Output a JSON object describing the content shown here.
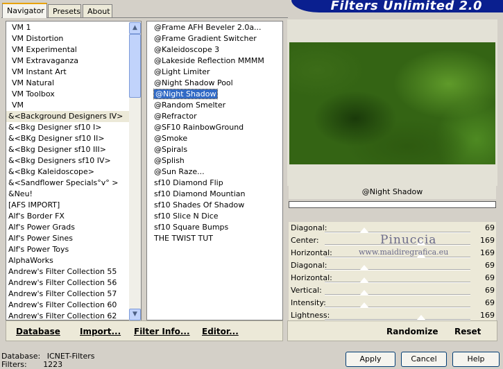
{
  "tabs": [
    {
      "label": "Navigator"
    },
    {
      "label": "Presets"
    },
    {
      "label": "About"
    }
  ],
  "banner": {
    "title": "Filters Unlimited 2.0"
  },
  "categories": [
    "VM 1",
    "VM Distortion",
    "VM Experimental",
    "VM Extravaganza",
    "VM Instant Art",
    "VM Natural",
    "VM Toolbox",
    "VM",
    "&<Background Designers IV>",
    "&<Bkg Designer sf10 I>",
    "&<BKg Designer sf10 II>",
    "&<Bkg Designer sf10 III>",
    "&<Bkg Designers sf10 IV>",
    "&<Bkg Kaleidoscope>",
    "&<Sandflower Specials°v° >",
    "&Neu!",
    "[AFS IMPORT]",
    "Alf's Border FX",
    "Alf's Power Grads",
    "Alf's Power Sines",
    "Alf's Power Toys",
    "AlphaWorks",
    "Andrew's Filter Collection 55",
    "Andrew's Filter Collection 56",
    "Andrew's Filter Collection 57",
    "Andrew's Filter Collection 60",
    "Andrew's Filter Collection 62"
  ],
  "selected_category": "&<Background Designers IV>",
  "filters": [
    "@Frame AFH Beveler 2.0a...",
    "@Frame Gradient Switcher",
    "@Kaleidoscope 3",
    "@Lakeside Reflection MMMM",
    "@Light Limiter",
    "@Night Shadow Pool",
    "@Night Shadow",
    "@Random Smelter",
    "@Refractor",
    "@SF10 RainbowGround",
    "@Smoke",
    "@Spirals",
    "@Splish",
    "@Sun Raze...",
    "sf10 Diamond Flip",
    "sf10 Diamond Mountian",
    "sf10 Shades Of Shadow",
    "sf10 Slice N Dice",
    "sf10 Square Bumps",
    "THE TWIST TUT"
  ],
  "selected_filter": "@Night Shadow",
  "left_toolbar": {
    "database": "Database",
    "import": "Import...",
    "filter_info": "Filter Info...",
    "editor": "Editor..."
  },
  "preview": {
    "filter_name": "@Night Shadow",
    "watermark": "Pinuccia",
    "watermark_url": "www.maidiregrafica.eu"
  },
  "sliders": [
    {
      "label": "Diagonal:",
      "value": "69",
      "level": 0.27
    },
    {
      "label": "Center:",
      "value": "169",
      "level": 0.66
    },
    {
      "label": "Horizontal:",
      "value": "169",
      "level": 0.66
    },
    {
      "label": "Diagonal:",
      "value": "69",
      "level": 0.27
    },
    {
      "label": "Horizontal:",
      "value": "69",
      "level": 0.27
    },
    {
      "label": "Vertical:",
      "value": "69",
      "level": 0.27
    },
    {
      "label": "Intensity:",
      "value": "69",
      "level": 0.27
    },
    {
      "label": "Lightness:",
      "value": "169",
      "level": 0.66
    }
  ],
  "right_toolbar": {
    "randomize": "Randomize",
    "reset": "Reset"
  },
  "status": {
    "database_label": "Database:",
    "database_value": "ICNET-Filters",
    "filters_label": "Filters:",
    "filters_value": "1223"
  },
  "buttons": {
    "apply": "Apply",
    "cancel": "Cancel",
    "help": "Help"
  }
}
